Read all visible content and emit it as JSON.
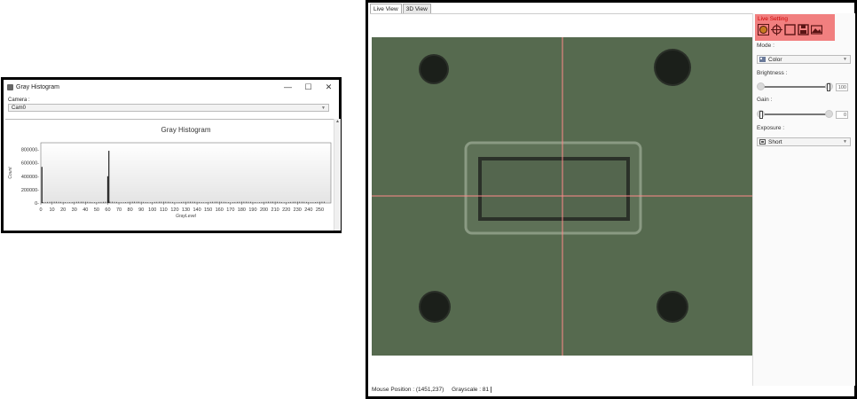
{
  "histogram_window": {
    "title": "Gray Histogram",
    "camera_label": "Camera :",
    "camera_value": "Cam0",
    "controls": [
      "—",
      "☐",
      "✕"
    ]
  },
  "chart_data": {
    "type": "bar",
    "title": "Gray Histogram",
    "xlabel": "GrayLevel",
    "ylabel": "Count",
    "xlim": [
      0,
      260
    ],
    "ylim": [
      0,
      900000
    ],
    "xticks": [
      "0",
      "10",
      "20",
      "30",
      "40",
      "50",
      "60",
      "70",
      "80",
      "90",
      "100",
      "110",
      "120",
      "130",
      "140",
      "150",
      "160",
      "170",
      "180",
      "190",
      "200",
      "210",
      "220",
      "230",
      "240",
      "250"
    ],
    "yticks": [
      "0-",
      "200000-",
      "400000-",
      "600000-",
      "800000-"
    ],
    "grid": false,
    "legend": "none",
    "bars": [
      {
        "x": 1,
        "value": 540000
      },
      {
        "x": 60,
        "value": 400000
      },
      {
        "x": 61,
        "value": 780000
      }
    ],
    "noise_level": 20000
  },
  "live_window": {
    "tabs": [
      "Live View",
      "3D View"
    ],
    "status": {
      "mouse_position": "Mouse Position : (1451,237)",
      "grayscale": "Grayscale : 81"
    },
    "panel": {
      "live_setting": "Live Setting",
      "icons": [
        "record-icon",
        "crosshair-icon",
        "roi-box-icon",
        "save-icon",
        "image-icon"
      ],
      "mode_label": "Mode :",
      "mode_value": "Color",
      "brightness_label": "Brightness :",
      "brightness_value": "100",
      "brightness_level": 1.0,
      "gain_label": "Gain :",
      "gain_value": "0",
      "gain_level": 0.0,
      "exposure_label": "Exposure :",
      "exposure_value": "Short"
    },
    "crosshair_color": "#ff8a8a",
    "highlight_color": "#f17f7f"
  }
}
